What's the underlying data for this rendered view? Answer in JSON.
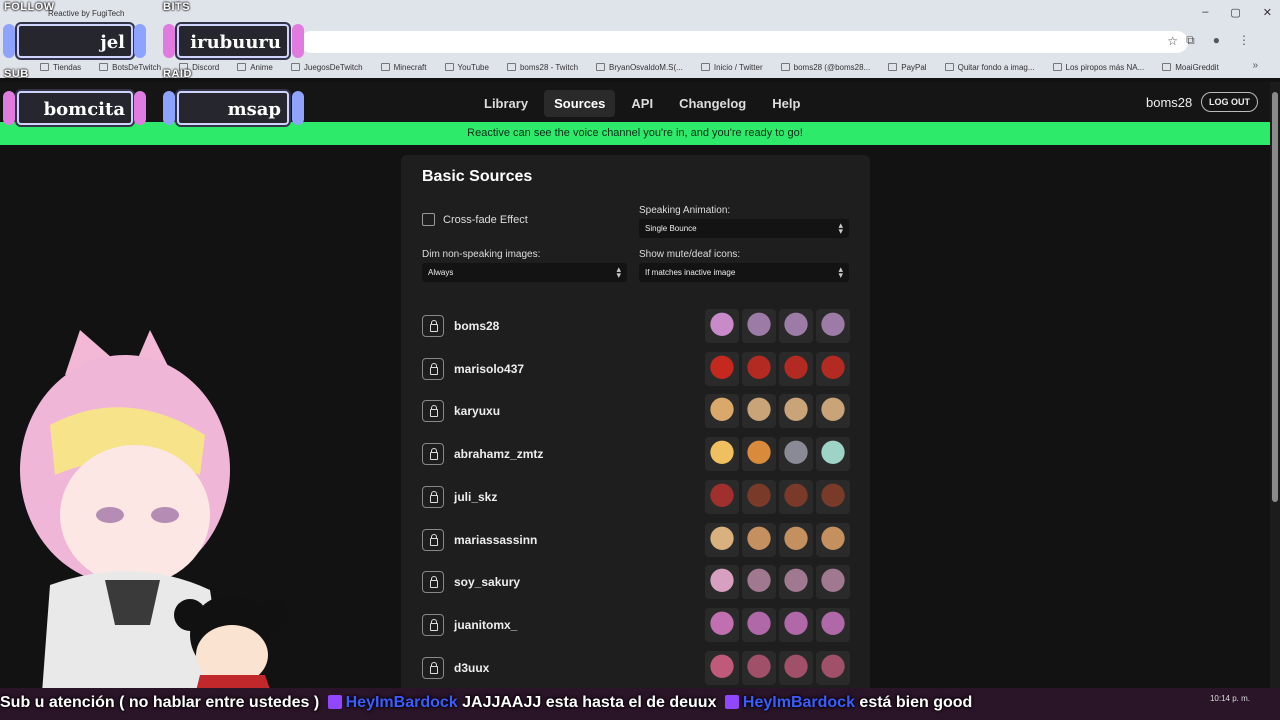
{
  "browser": {
    "tab_title": "Reactive by FugiTech",
    "bookmarks": [
      "Tiendas",
      "BotsDeTwitch",
      "Discord",
      "Anime",
      "JuegosDeTwitch",
      "Minecraft",
      "YouTube",
      "boms28 - Twitch",
      "BryanOsvaldoM.S(...",
      "Inicio / Twitter",
      "boms28 (@boms28...",
      "PayPal",
      "Quitar fondo a imag...",
      "Los piropos más NA...",
      "MoaiGreddit"
    ],
    "bookmark_more": "»"
  },
  "overlay": {
    "follow_label": "FOLLOW",
    "follow_name": "jel",
    "bits_label": "BITS",
    "bits_name": "irubuuru",
    "sub_label": "SUB",
    "sub_name": "bomcita",
    "raid_label": "RAID",
    "raid_name": "msap",
    "marquee_parts": [
      "Sub",
      "u atención ( no hablar entre ustedes )",
      "HeyImBardock",
      "JAJJAAJJ esta hasta el de deuux",
      "HeyImBardock",
      "está bien good"
    ],
    "clock": "10:14 p. m."
  },
  "nav": {
    "links": [
      "Library",
      "Sources",
      "API",
      "Changelog",
      "Help"
    ],
    "active": "Sources",
    "user": "boms28",
    "logout": "LOG OUT"
  },
  "banner": "Reactive can see the voice channel you're in, and you're ready to go!",
  "panel": {
    "title": "Basic Sources",
    "crossfade_label": "Cross-fade Effect",
    "speaking_anim_label": "Speaking Animation:",
    "speaking_anim_value": "Single Bounce",
    "dim_label": "Dim non-speaking images:",
    "dim_value": "Always",
    "mute_label": "Show mute/deaf icons:",
    "mute_value": "If matches inactive image",
    "users": [
      {
        "name": "boms28",
        "colors": [
          "#c98ac9",
          "#9c7ba6",
          "#9c7ba6",
          "#9c7ba6"
        ]
      },
      {
        "name": "marisolo437",
        "colors": [
          "#c4281e",
          "#b32a22",
          "#b32a22",
          "#b32a22"
        ]
      },
      {
        "name": "karyuxu",
        "colors": [
          "#d9a86a",
          "#c9a478",
          "#c9a478",
          "#c9a478"
        ]
      },
      {
        "name": "abrahamz_zmtz",
        "colors": [
          "#f0c060",
          "#d98a3a",
          "#8a8a96",
          "#9fd3c8"
        ]
      },
      {
        "name": "juli_skz",
        "colors": [
          "#a0302e",
          "#7a3a2a",
          "#7a3a2a",
          "#7a3a2a"
        ]
      },
      {
        "name": "mariassassinn",
        "colors": [
          "#d9b080",
          "#c49060",
          "#c49060",
          "#c49060"
        ]
      },
      {
        "name": "soy_sakury",
        "colors": [
          "#d8a0c0",
          "#a07890",
          "#a07890",
          "#a07890"
        ]
      },
      {
        "name": "juanitomx_",
        "colors": [
          "#c070b0",
          "#b068a8",
          "#b068a8",
          "#b068a8"
        ]
      },
      {
        "name": "d3uux",
        "colors": [
          "#c05a7a",
          "#a05068",
          "#a05068",
          "#a05068"
        ]
      }
    ]
  }
}
